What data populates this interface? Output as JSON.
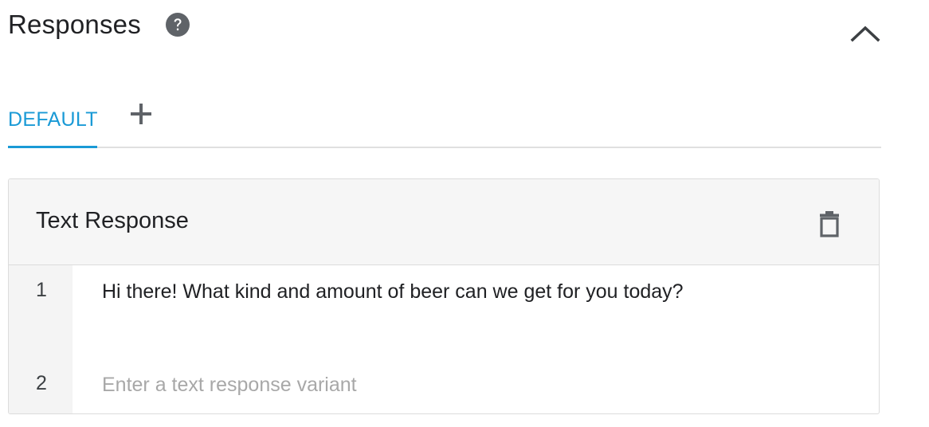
{
  "header": {
    "title": "Responses",
    "help_icon": "help-circle-icon",
    "collapse_icon": "chevron-up-icon"
  },
  "tabs": {
    "items": [
      {
        "label": "DEFAULT",
        "active": true
      }
    ],
    "add_icon": "plus-icon"
  },
  "card": {
    "title": "Text Response",
    "delete_icon": "trash-icon",
    "rows": [
      {
        "number": "1",
        "text": "Hi there! What kind and amount of beer can we get for you today?"
      },
      {
        "number": "2",
        "value": "",
        "placeholder": "Enter a text response variant"
      }
    ]
  },
  "colors": {
    "accent": "#1a9ad6",
    "text": "#202124",
    "icon": "#5f6368",
    "placeholder": "#a8a8a8",
    "header_bg": "#f6f6f6",
    "border": "#dcdcdc"
  }
}
